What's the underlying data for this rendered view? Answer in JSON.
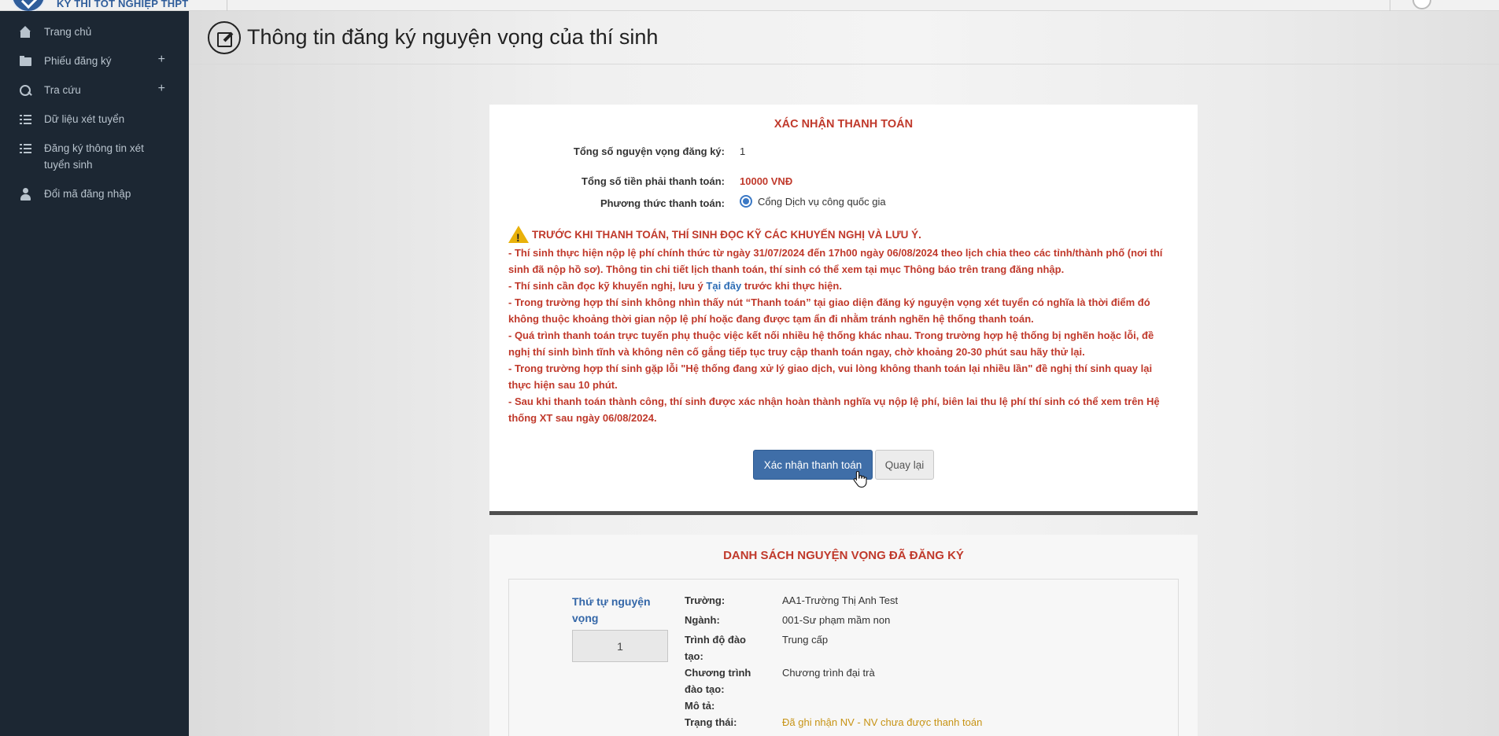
{
  "app": {
    "logo_text": "KỲ THI TỐT NGHIỆP THPT"
  },
  "sidebar": {
    "items": [
      {
        "label": "Trang chủ",
        "icon": "home-icon",
        "expandable": false
      },
      {
        "label": "Phiếu đăng ký",
        "icon": "folder-icon",
        "expandable": true
      },
      {
        "label": "Tra cứu",
        "icon": "search-icon",
        "expandable": true
      },
      {
        "label": "Dữ liệu xét tuyển",
        "icon": "list-icon",
        "expandable": false
      },
      {
        "label": "Đăng ký thông tin xét tuyển sinh",
        "icon": "list-icon",
        "expandable": false
      },
      {
        "label": "Đổi mã đăng nhập",
        "icon": "user-icon",
        "expandable": false
      }
    ],
    "plus_glyph": "+"
  },
  "page": {
    "title": "Thông tin đăng ký nguyện vọng của thí sinh"
  },
  "payment": {
    "title": "XÁC NHẬN THANH TOÁN",
    "total_nv_label": "Tổng số nguyện vọng đăng ký:",
    "total_nv_value": "1",
    "total_amount_label": "Tổng số tiền phải thanh toán:",
    "total_amount_value": "10000 VNĐ",
    "method_label": "Phương thức thanh toán:",
    "method_value": "Cổng Dịch vụ công quốc gia",
    "warning_title": "TRƯỚC KHI THANH TOÁN, THÍ SINH ĐỌC KỸ CÁC KHUYẾN NGHỊ VÀ LƯU Ý.",
    "warning_lines": [
      "- Thí sinh thực hiện nộp lệ phí chính thức từ ngày 31/07/2024 đến 17h00 ngày 06/08/2024 theo lịch chia theo các tỉnh/thành phố (nơi thí sinh đã nộp hồ sơ). Thông tin chi tiết lịch thanh toán, thí sinh có thể xem tại mục Thông báo trên trang đăng nhập."
    ],
    "warning_line2_before": "- Thí sinh cần đọc kỹ khuyến nghị, lưu ý ",
    "warning_line2_link": "Tại đây",
    "warning_line2_after": " trước khi thực hiện.",
    "warning_rest": [
      "- Trong trường hợp thí sinh không nhìn thấy nút “Thanh toán” tại giao diện đăng ký nguyện vọng xét tuyển có nghĩa là thời điểm đó không thuộc khoảng thời gian nộp lệ phí hoặc đang được tạm ẩn đi nhằm tránh nghẽn hệ thống thanh toán.",
      "- Quá trình thanh toán trực tuyến phụ thuộc việc kết nối nhiều hệ thống khác nhau. Trong trường hợp hệ thống bị nghẽn hoặc lỗi, đề nghị thí sinh bình tĩnh và không nên cố gắng tiếp tục truy cập thanh toán ngay, chờ khoảng 20-30 phút sau hãy thử lại.",
      "- Trong trường hợp thí sinh gặp lỗi \"Hệ thống đang xử lý giao dịch, vui lòng không thanh toán lại nhiều lần\" đề nghị thí sinh quay lại thực hiện sau 10 phút.",
      "- Sau khi thanh toán thành công, thí sinh được xác nhận hoàn thành nghĩa vụ nộp lệ phí, biên lai thu lệ phí thí sinh có thể xem trên Hệ thống XT sau ngày 06/08/2024."
    ],
    "confirm_button": "Xác nhận thanh toán",
    "back_button": "Quay lại"
  },
  "nv_list": {
    "title": "DANH SÁCH NGUYỆN VỌNG ĐÃ ĐĂNG KÝ",
    "order_label": "Thứ tự nguyện vọng",
    "order_value": "1",
    "fields": {
      "truong_label": "Trường:",
      "truong_value": "AA1-Trường Thị Anh Test",
      "nganh_label": "Ngành:",
      "nganh_value": "001-Sư phạm mầm non",
      "trinhdo_label": "Trình độ đào tạo:",
      "trinhdo_value": "Trung cấp",
      "chuongtrinh_label": "Chương trình đào tạo:",
      "chuongtrinh_value": "Chương trình đại trà",
      "mota_label": "Mô tả:",
      "trangthai_label": "Trạng thái:",
      "trangthai_value": "Đã ghi nhận NV - NV chưa được thanh toán"
    }
  },
  "colors": {
    "sidebar_bg": "#1c2733",
    "accent_red": "#c0392b",
    "primary_button": "#3f6ea8",
    "status_amber": "#c79314",
    "link_blue": "#2d6db5"
  }
}
